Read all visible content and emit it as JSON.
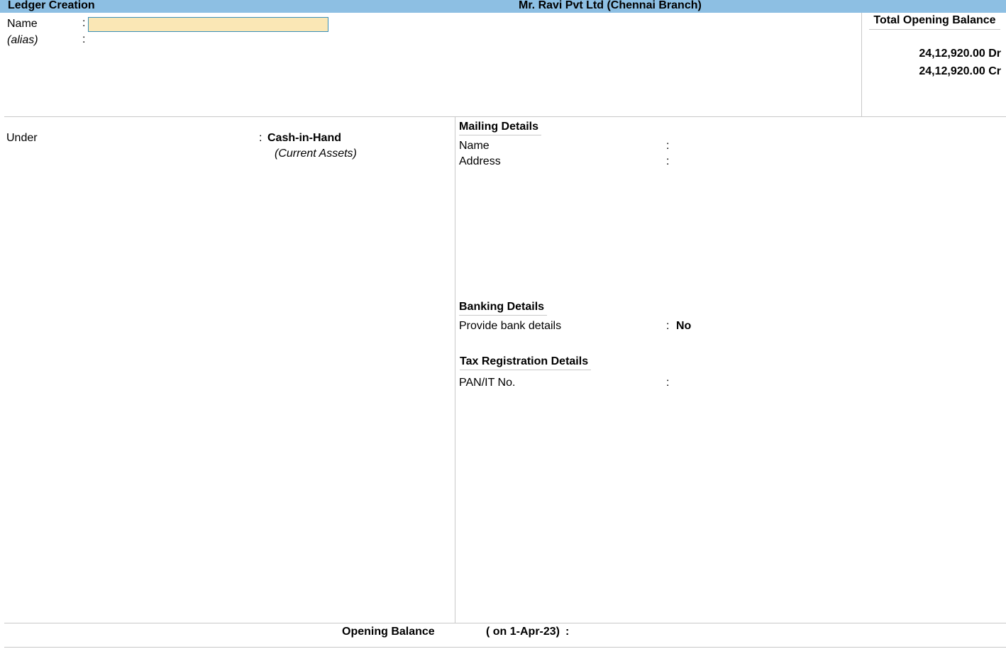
{
  "header": {
    "screen_title": "Ledger Creation",
    "company": "Mr. Ravi Pvt Ltd (Chennai Branch)"
  },
  "form": {
    "name_label": "Name",
    "name_value": "",
    "alias_label": "(alias)",
    "separator": ":"
  },
  "total_opening_balance": {
    "heading": "Total Opening Balance",
    "debit": "24,12,920.00 Dr",
    "credit": "24,12,920.00 Cr"
  },
  "under": {
    "label": "Under",
    "group": "Cash-in-Hand",
    "parent_group": "(Current Assets)"
  },
  "mailing": {
    "heading": "Mailing Details",
    "name_label": "Name",
    "address_label": "Address"
  },
  "banking": {
    "heading": "Banking Details",
    "provide_label": "Provide bank details",
    "provide_value": "No"
  },
  "tax": {
    "heading": "Tax Registration Details",
    "pan_label": "PAN/IT No."
  },
  "footer": {
    "opening_balance_label": "Opening Balance",
    "opening_date": "( on 1-Apr-23)",
    "opening_value": ""
  },
  "colors": {
    "title_bar": "#8dbfe3",
    "input_active": "#fae7b5",
    "input_border": "#3a8fb7"
  }
}
